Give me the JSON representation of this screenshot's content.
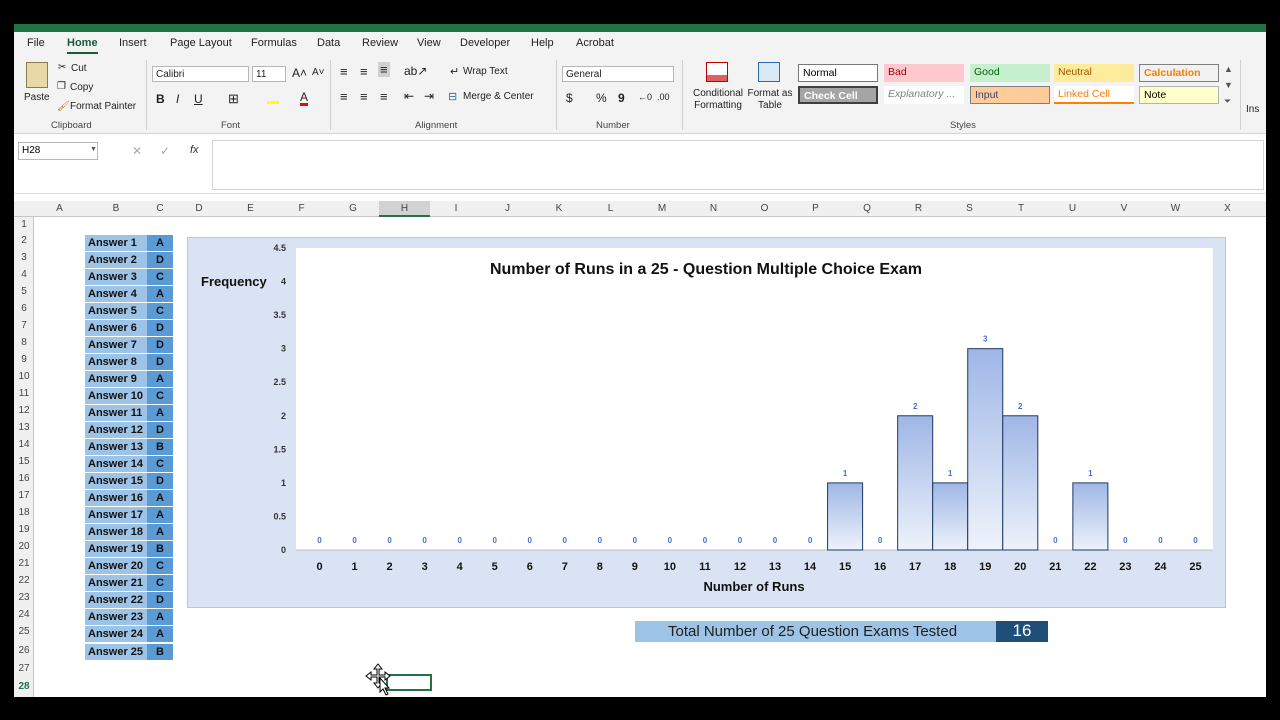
{
  "menu": [
    "File",
    "Home",
    "Insert",
    "Page Layout",
    "Formulas",
    "Data",
    "Review",
    "View",
    "Developer",
    "Help",
    "Acrobat"
  ],
  "ribbon": {
    "clipboard": {
      "paste": "Paste",
      "cut": "Cut",
      "copy": "Copy",
      "format_painter": "Format Painter",
      "label": "Clipboard"
    },
    "font": {
      "name": "Calibri",
      "size": "11",
      "bold": "B",
      "italic": "I",
      "underline": "U",
      "label": "Font"
    },
    "alignment": {
      "wrap": "Wrap Text",
      "merge": "Merge & Center",
      "label": "Alignment"
    },
    "number": {
      "format": "General",
      "currency": "$",
      "percent": "%",
      "comma": "9",
      "label": "Number"
    },
    "conditional": "Conditional Formatting",
    "format_table": "Format as Table",
    "styles": {
      "label": "Styles",
      "items": [
        {
          "name": "Normal",
          "bg": "#ffffff",
          "fg": "#000000"
        },
        {
          "name": "Bad",
          "bg": "#ffc7ce",
          "fg": "#9c0006"
        },
        {
          "name": "Good",
          "bg": "#c6efce",
          "fg": "#006100"
        },
        {
          "name": "Neutral",
          "bg": "#ffeb9c",
          "fg": "#9c5700"
        },
        {
          "name": "Calculation",
          "bg": "#f2f2f2",
          "fg": "#fa7d00"
        },
        {
          "name": "Check Cell",
          "bg": "#a5a5a5",
          "fg": "#ffffff"
        },
        {
          "name": "Explanatory ...",
          "bg": "#ffffff",
          "fg": "#7f7f7f"
        },
        {
          "name": "Input",
          "bg": "#ffcc99",
          "fg": "#3f3f76"
        },
        {
          "name": "Linked Cell",
          "bg": "#ffffff",
          "fg": "#fa7d00"
        },
        {
          "name": "Note",
          "bg": "#ffffcc",
          "fg": "#000000"
        }
      ]
    },
    "insert_cut": "Ins"
  },
  "formula_bar": {
    "name_box": "H28",
    "fx": "fx"
  },
  "columns": [
    "A",
    "B",
    "C",
    "D",
    "E",
    "F",
    "G",
    "H",
    "I",
    "J",
    "K",
    "L",
    "M",
    "N",
    "O",
    "P",
    "Q",
    "R",
    "S",
    "T",
    "U",
    "V",
    "W",
    "X"
  ],
  "selected_column": "H",
  "rows": [
    "1",
    "2",
    "3",
    "4",
    "5",
    "6",
    "7",
    "8",
    "9",
    "10",
    "11",
    "12",
    "13",
    "14",
    "15",
    "16",
    "17",
    "18",
    "19",
    "20",
    "21",
    "22",
    "23",
    "24",
    "25",
    "26",
    "27",
    "28"
  ],
  "answers": [
    {
      "label": "Answer 1",
      "value": "A"
    },
    {
      "label": "Answer 2",
      "value": "D"
    },
    {
      "label": "Answer 3",
      "value": "C"
    },
    {
      "label": "Answer 4",
      "value": "A"
    },
    {
      "label": "Answer 5",
      "value": "C"
    },
    {
      "label": "Answer 6",
      "value": "D"
    },
    {
      "label": "Answer 7",
      "value": "D"
    },
    {
      "label": "Answer 8",
      "value": "D"
    },
    {
      "label": "Answer 9",
      "value": "A"
    },
    {
      "label": "Answer 10",
      "value": "C"
    },
    {
      "label": "Answer 11",
      "value": "A"
    },
    {
      "label": "Answer 12",
      "value": "D"
    },
    {
      "label": "Answer 13",
      "value": "B"
    },
    {
      "label": "Answer 14",
      "value": "C"
    },
    {
      "label": "Answer 15",
      "value": "D"
    },
    {
      "label": "Answer 16",
      "value": "A"
    },
    {
      "label": "Answer 17",
      "value": "A"
    },
    {
      "label": "Answer 18",
      "value": "A"
    },
    {
      "label": "Answer 19",
      "value": "B"
    },
    {
      "label": "Answer 20",
      "value": "C"
    },
    {
      "label": "Answer 21",
      "value": "C"
    },
    {
      "label": "Answer 22",
      "value": "D"
    },
    {
      "label": "Answer 23",
      "value": "A"
    },
    {
      "label": "Answer 24",
      "value": "A"
    },
    {
      "label": "Answer 25",
      "value": "B"
    }
  ],
  "chart_data": {
    "type": "bar",
    "title": "Number of Runs in a 25 - Question Multiple Choice Exam",
    "xlabel": "Number of Runs",
    "ylabel": "Frequency",
    "categories": [
      "0",
      "1",
      "2",
      "3",
      "4",
      "5",
      "6",
      "7",
      "8",
      "9",
      "10",
      "11",
      "12",
      "13",
      "14",
      "15",
      "16",
      "17",
      "18",
      "19",
      "20",
      "21",
      "22",
      "23",
      "24",
      "25"
    ],
    "values": [
      0,
      0,
      0,
      0,
      0,
      0,
      0,
      0,
      0,
      0,
      0,
      0,
      0,
      0,
      0,
      1,
      0,
      2,
      1,
      3,
      2,
      0,
      1,
      0,
      0,
      0
    ],
    "yticks": [
      "0",
      "0.5",
      "1",
      "1.5",
      "2",
      "2.5",
      "3",
      "3.5",
      "4",
      "4.5"
    ],
    "ylim": [
      0,
      4.5
    ],
    "bar_color": "#b4c7e7",
    "legend": "none"
  },
  "total": {
    "label": "Total Number of 25 Question Exams Tested",
    "value": "16"
  }
}
